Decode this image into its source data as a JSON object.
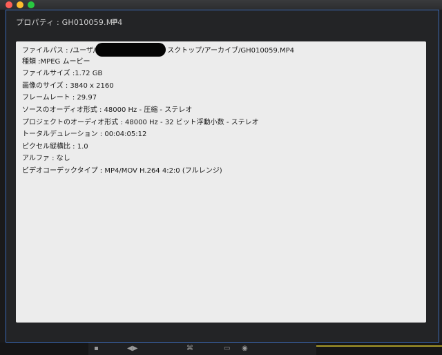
{
  "panel": {
    "title": "プロパティ : GH010059.MP4",
    "menu_icon": "hamburger-menu-icon"
  },
  "properties": {
    "file_path": {
      "prefix": "ファイルパス : /ユーザ/",
      "suffix": "スクトップ/アーカイブ/GH010059.MP4"
    },
    "rows": [
      "種類 :MPEG ムービー",
      "ファイルサイズ :1.72 GB",
      "画像のサイズ : 3840 x 2160",
      "フレームレート : 29.97",
      "ソースのオーディオ形式 : 48000 Hz - 圧縮 - ステレオ",
      "プロジェクトのオーディオ形式 : 48000 Hz - 32 ビット浮動小数 - ステレオ",
      "トータルデュレーション : 00:04:05:12",
      "ピクセル縦横比 : 1.0",
      "アルファ : なし",
      "ビデオコーデックタイプ : MP4/MOV H.264 4:2:0  (フルレンジ)"
    ]
  },
  "colors": {
    "panel_border": "#3d6bb8",
    "content_bg": "#ececec",
    "text": "#1a1a1a"
  }
}
